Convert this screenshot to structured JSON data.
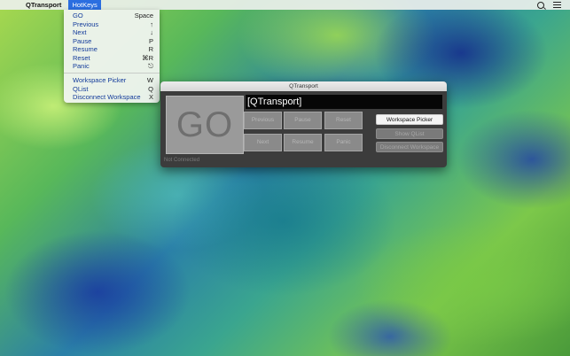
{
  "menubar": {
    "apple_glyph": "",
    "app_name": "QTransport",
    "active_menu": "HotKeys"
  },
  "hotkeys_menu": {
    "items": [
      {
        "label": "GO",
        "shortcut": "Space"
      },
      {
        "label": "Previous",
        "shortcut": "↑"
      },
      {
        "label": "Next",
        "shortcut": "↓"
      },
      {
        "label": "Pause",
        "shortcut": "P"
      },
      {
        "label": "Resume",
        "shortcut": "R"
      },
      {
        "label": "Reset",
        "shortcut": "⌘R"
      },
      {
        "label": "Panic",
        "shortcut": "⎋"
      },
      {
        "label": "Workspace Picker",
        "shortcut": "W"
      },
      {
        "label": "QList",
        "shortcut": "Q"
      },
      {
        "label": "Disconnect Workspace",
        "shortcut": "X"
      }
    ]
  },
  "window": {
    "title": "QTransport",
    "go_label": "GO",
    "workspace_name": "[QTransport]",
    "transport": {
      "previous": "Previous",
      "pause": "Pause",
      "reset": "Reset",
      "next": "Next",
      "resume": "Resume",
      "panic": "Panic"
    },
    "side": {
      "workspace_picker": "Workspace Picker",
      "show_qlist": "Show QList",
      "disconnect": "Disconnect Workspace"
    },
    "status": "Not Connected"
  },
  "colors": {
    "menu_highlight": "#2b6ee0",
    "menu_text": "#123a9a"
  }
}
